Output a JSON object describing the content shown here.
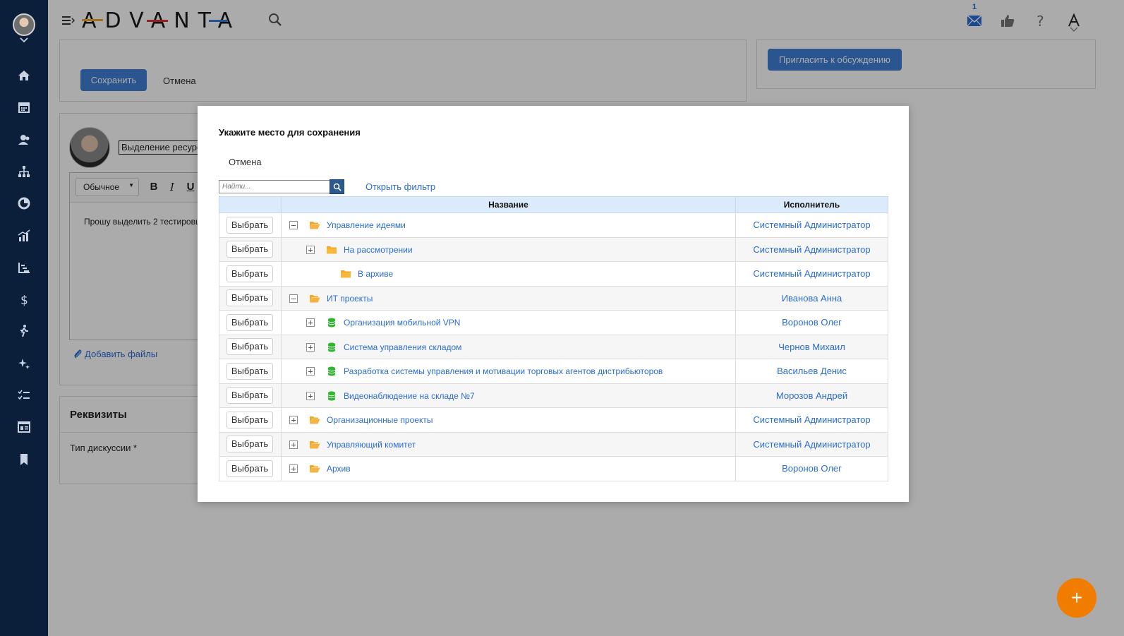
{
  "header": {
    "logo_text": "ADVANTA",
    "mail_count": "1"
  },
  "colors": {
    "sidebar_bg": "#0b1f3b",
    "accent_blue": "#3f7fd6",
    "link_blue": "#2b6cd4",
    "folder_orange": "#f5a623",
    "project_green": "#2eb82e",
    "fab_orange": "#f07d00"
  },
  "sidebar": {
    "icons": [
      "home-icon",
      "calendar-icon",
      "contacts-icon",
      "org-structure-icon",
      "pie-chart-icon",
      "analytics-icon",
      "gantt-icon",
      "finance-icon",
      "activity-icon",
      "magic-icon",
      "checklist-icon",
      "news-icon",
      "bookmark-icon"
    ]
  },
  "background": {
    "save_label": "Сохранить",
    "cancel_label": "Отмена",
    "invite_label": "Пригласить к обсуждению",
    "title_value": "Выделение ресурс",
    "style_select": "Обычное",
    "bold": "B",
    "italic": "I",
    "underline": "U",
    "editor_text": "Прошу выделить 2 тестировщ",
    "add_files": "Добавить файлы",
    "section_title": "Реквизиты",
    "discussion_type_label": "Тип дискуссии *",
    "fab_label": "+"
  },
  "modal": {
    "title": "Укажите место для сохранения",
    "cancel_label": "Отмена",
    "search_placeholder": "Найти...",
    "filter_link": "Открыть фильтр",
    "columns": {
      "name": "Название",
      "executor": "Исполнитель"
    },
    "select_label": "Выбрать",
    "rows": [
      {
        "name": "Управление идеями",
        "executor": "Системный Администратор",
        "level": 0,
        "toggle": "minus",
        "icon": "folder-open"
      },
      {
        "name": "На рассмотрении",
        "executor": "Системный Администратор",
        "level": 1,
        "toggle": "plus",
        "icon": "folder"
      },
      {
        "name": "В архиве",
        "executor": "Системный Администратор",
        "level": 1,
        "toggle": "none",
        "icon": "folder"
      },
      {
        "name": "ИТ проекты",
        "executor": "Иванова Анна",
        "level": 0,
        "toggle": "minus",
        "icon": "folder-open"
      },
      {
        "name": "Организация мобильной VPN",
        "executor": "Воронов Олег",
        "level": 1,
        "toggle": "plus",
        "icon": "project"
      },
      {
        "name": "Система управления складом",
        "executor": "Чернов Михаил",
        "level": 1,
        "toggle": "plus",
        "icon": "project"
      },
      {
        "name": "Разработка системы управления и мотивации торговых агентов дистрибьюторов",
        "executor": "Васильев Денис",
        "level": 1,
        "toggle": "plus",
        "icon": "project"
      },
      {
        "name": "Видеонаблюдение на складе №7",
        "executor": "Морозов Андрей",
        "level": 1,
        "toggle": "plus",
        "icon": "project"
      },
      {
        "name": "Организационные проекты",
        "executor": "Системный Администратор",
        "level": 0,
        "toggle": "plus",
        "icon": "folder-open"
      },
      {
        "name": "Управляющий комитет",
        "executor": "Системный Администратор",
        "level": 0,
        "toggle": "plus",
        "icon": "folder-open"
      },
      {
        "name": "Архив",
        "executor": "Воронов Олег",
        "level": 0,
        "toggle": "plus",
        "icon": "folder-open"
      }
    ]
  }
}
